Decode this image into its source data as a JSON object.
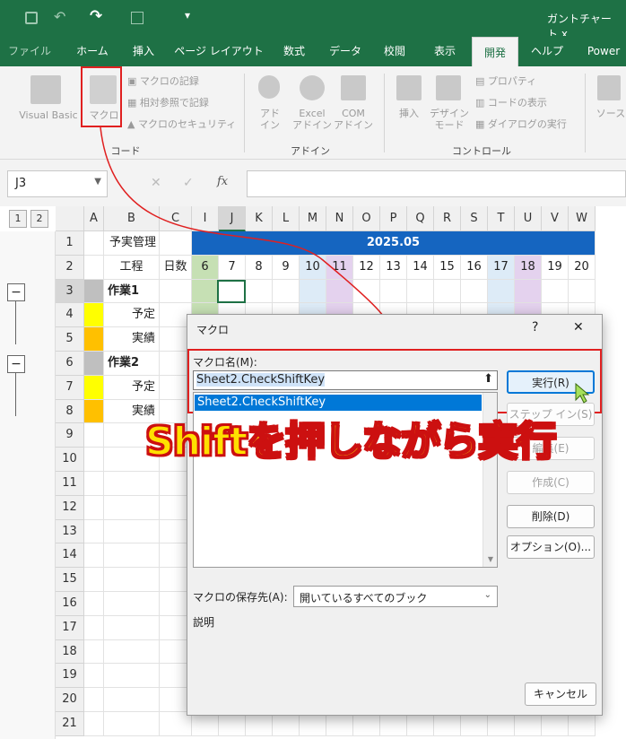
{
  "window": {
    "title": "ガントチャート.x"
  },
  "tabs": [
    {
      "label": "ファイル"
    },
    {
      "label": "ホーム"
    },
    {
      "label": "挿入"
    },
    {
      "label": "ページ レイアウト"
    },
    {
      "label": "数式"
    },
    {
      "label": "データ"
    },
    {
      "label": "校閲"
    },
    {
      "label": "表示"
    },
    {
      "label": "開発"
    },
    {
      "label": "ヘルプ"
    },
    {
      "label": "Power"
    }
  ],
  "ribbon": {
    "visual_basic": "Visual Basic",
    "macro": "マクロ",
    "record_macro": "マクロの記録",
    "relative_ref": "相対参照で記録",
    "macro_security": "マクロのセキュリティ",
    "addin": "アド\nイン",
    "excel_addin": "Excel\nアドイン",
    "com_addin": "COM\nアドイン",
    "insert": "挿入",
    "design_mode": "デザイン\nモード",
    "properties": "プロパティ",
    "view_code": "コードの表示",
    "run_dialog": "ダイアログの実行",
    "source": "ソース",
    "group_code": "コード",
    "group_addin": "アドイン",
    "group_control": "コントロール"
  },
  "formula_bar": {
    "name_box": "J3",
    "fx": "fx"
  },
  "outline_levels": [
    "1",
    "2"
  ],
  "columns": [
    "A",
    "B",
    "C",
    "I",
    "J",
    "K",
    "L",
    "M",
    "N",
    "O",
    "P",
    "Q",
    "R",
    "S",
    "T",
    "U",
    "V",
    "W"
  ],
  "rows": [
    "1",
    "2",
    "3",
    "4",
    "5",
    "6",
    "7",
    "8",
    "9",
    "10",
    "11",
    "12",
    "13",
    "14",
    "15",
    "16",
    "17",
    "18",
    "19",
    "20",
    "21"
  ],
  "sheet": {
    "b1": "予実管理",
    "month": "2025.05",
    "b2": "工程",
    "c2": "日数",
    "days": [
      "6",
      "7",
      "8",
      "9",
      "10",
      "11",
      "12",
      "13",
      "14",
      "15",
      "16",
      "17",
      "18",
      "19",
      "20"
    ],
    "task1": "作業1",
    "task2": "作業2",
    "plan": "予定",
    "actual": "実績"
  },
  "dialog": {
    "title": "マクロ",
    "help": "?",
    "close": "✕",
    "macro_name_label": "マクロ名(M):",
    "macro_name_value": "Sheet2.CheckShiftKey",
    "macro_list": [
      "Sheet2.CheckShiftKey"
    ],
    "buttons": {
      "run": "実行(R)",
      "step": "ステップ イン(S)",
      "edit": "編集(E)",
      "create": "作成(C)",
      "delete": "削除(D)",
      "options": "オプション(O)..."
    },
    "save_in_label": "マクロの保存先(A):",
    "save_in_value": "開いているすべてのブック",
    "description_label": "説明",
    "cancel": "キャンセル"
  },
  "overlay_text": "Shiftを押しながら実行",
  "colors": {
    "excel_green": "#1e7145",
    "month_band": "#1565c0",
    "highlight_red": "#e02020",
    "plan_yellow": "#ffff00",
    "actual_orange": "#ffc000",
    "weekend_green": "#c6e0b4",
    "weekend_blue": "#ddebf7",
    "weekend_purple": "#e4d2ee"
  }
}
